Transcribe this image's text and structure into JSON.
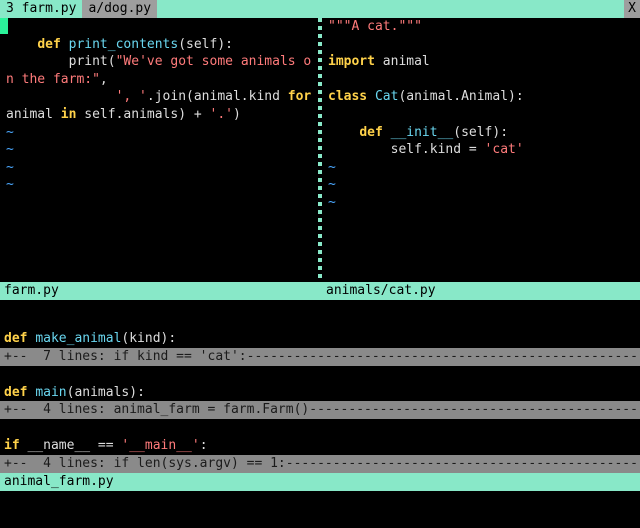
{
  "tabline": {
    "inactive_count": "3",
    "inactive_label": "farm.py",
    "active_label": "a/dog.py",
    "close_label": "X"
  },
  "pane_left": {
    "status": "farm.py",
    "code": {
      "l1": "",
      "l2_pre": "    ",
      "l2_def": "def",
      "l2_sp": " ",
      "l2_fn": "print_contents",
      "l2_post": "(self):",
      "l3_pre": "        print(",
      "l3_str": "\"We've got some animals on the farm:\"",
      "l3_post": ",",
      "l4_pre": "              ",
      "l4_str1": "', '",
      "l4_mid1": ".join(animal.kind ",
      "l4_for": "for",
      "l4_mid2": " animal ",
      "l4_in": "in",
      "l4_mid3": " self.animals) + ",
      "l4_str2": "'.'",
      "l4_post": ")"
    },
    "tildes": [
      "~",
      "~",
      "~",
      "~"
    ]
  },
  "pane_right": {
    "status": "animals/cat.py",
    "code": {
      "l1": "\"\"\"A cat.\"\"\"",
      "l2": "",
      "l3_imp": "import",
      "l3_mod": " animal",
      "l4": "",
      "l5_cls": "class",
      "l5_sp": " ",
      "l5_nm": "Cat",
      "l5_post": "(animal.Animal):",
      "l6": "",
      "l7_pre": "    ",
      "l7_def": "def",
      "l7_sp": " ",
      "l7_fn": "__init__",
      "l7_post": "(self):",
      "l8_pre": "        self.kind = ",
      "l8_str": "'cat'"
    },
    "tildes": [
      "~",
      "~",
      "~"
    ]
  },
  "bottom": {
    "status": "animal_farm.py",
    "line_make_pre": "def",
    "line_make_sp": " ",
    "line_make_fn": "make_animal",
    "line_make_post": "(kind):",
    "fold1": "+--  7 lines: if kind == 'cat':--------------------------------------------------",
    "line_main_pre": "def",
    "line_main_sp": " ",
    "line_main_fn": "main",
    "line_main_post": "(animals):",
    "fold2": "+--  4 lines: animal_farm = farm.Farm()------------------------------------------",
    "line_if_pre": "if",
    "line_if_mid": " __name__ == ",
    "line_if_str": "'__main__'",
    "line_if_post": ":",
    "fold3": "+--  4 lines: if len(sys.argv) == 1:---------------------------------------------"
  }
}
